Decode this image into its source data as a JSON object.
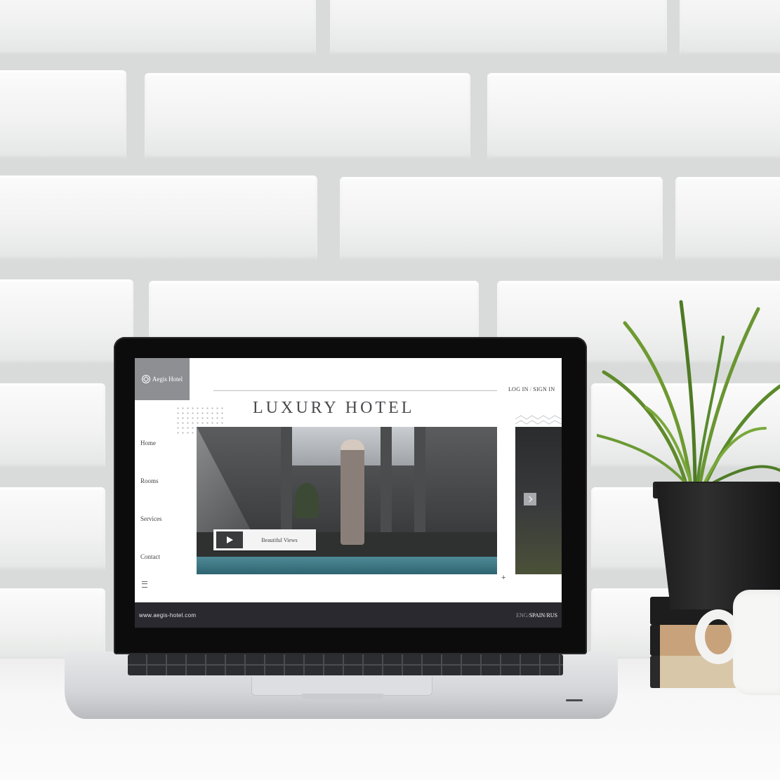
{
  "site": {
    "brand": "Aegis Hotel",
    "auth": {
      "login": "LOG IN",
      "separator": "/",
      "signin": "SIGN IN"
    },
    "hero_title": "LUXURY HOTEL",
    "nav": [
      {
        "label": "Home"
      },
      {
        "label": "Rooms"
      },
      {
        "label": "Services"
      },
      {
        "label": "Contact"
      }
    ],
    "video": {
      "label": "Beautiful Views"
    },
    "footer": {
      "url": "www.aegis-hotel.com",
      "languages": [
        "ENG",
        "SPAIN",
        "RUS"
      ],
      "lang_separator": "/"
    }
  },
  "icons": {
    "logo": "hexagon-logo-icon",
    "play": "play-icon",
    "next": "chevron-right-icon",
    "add": "plus-icon",
    "menu": "hamburger-icon"
  },
  "colors": {
    "logo_bg": "#8e8f93",
    "footer_bg": "#2a292f",
    "title": "#4a4a4e",
    "pool": "#4f8a96"
  }
}
